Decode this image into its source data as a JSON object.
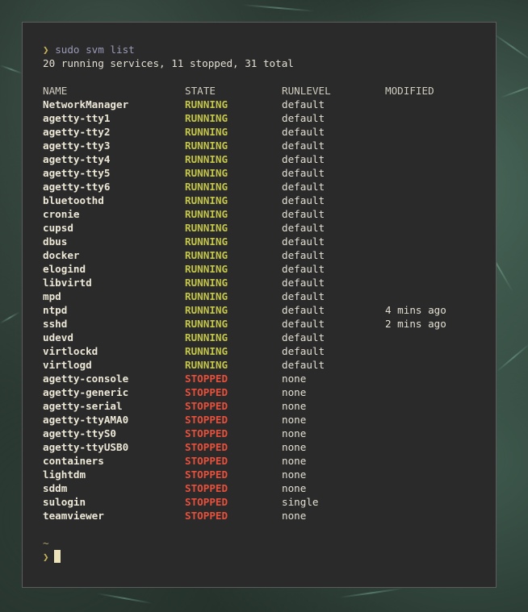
{
  "terminal": {
    "prompt_symbol": "❯",
    "command": "sudo svm list",
    "summary": "20 running services, 11 stopped, 31 total",
    "headers": {
      "name": "NAME",
      "state": "STATE",
      "runlevel": "RUNLEVEL",
      "modified": "MODIFIED"
    },
    "services": [
      {
        "name": "NetworkManager",
        "state": "RUNNING",
        "runlevel": "default",
        "modified": ""
      },
      {
        "name": "agetty-tty1",
        "state": "RUNNING",
        "runlevel": "default",
        "modified": ""
      },
      {
        "name": "agetty-tty2",
        "state": "RUNNING",
        "runlevel": "default",
        "modified": ""
      },
      {
        "name": "agetty-tty3",
        "state": "RUNNING",
        "runlevel": "default",
        "modified": ""
      },
      {
        "name": "agetty-tty4",
        "state": "RUNNING",
        "runlevel": "default",
        "modified": ""
      },
      {
        "name": "agetty-tty5",
        "state": "RUNNING",
        "runlevel": "default",
        "modified": ""
      },
      {
        "name": "agetty-tty6",
        "state": "RUNNING",
        "runlevel": "default",
        "modified": ""
      },
      {
        "name": "bluetoothd",
        "state": "RUNNING",
        "runlevel": "default",
        "modified": ""
      },
      {
        "name": "cronie",
        "state": "RUNNING",
        "runlevel": "default",
        "modified": ""
      },
      {
        "name": "cupsd",
        "state": "RUNNING",
        "runlevel": "default",
        "modified": ""
      },
      {
        "name": "dbus",
        "state": "RUNNING",
        "runlevel": "default",
        "modified": ""
      },
      {
        "name": "docker",
        "state": "RUNNING",
        "runlevel": "default",
        "modified": ""
      },
      {
        "name": "elogind",
        "state": "RUNNING",
        "runlevel": "default",
        "modified": ""
      },
      {
        "name": "libvirtd",
        "state": "RUNNING",
        "runlevel": "default",
        "modified": ""
      },
      {
        "name": "mpd",
        "state": "RUNNING",
        "runlevel": "default",
        "modified": ""
      },
      {
        "name": "ntpd",
        "state": "RUNNING",
        "runlevel": "default",
        "modified": "4 mins ago"
      },
      {
        "name": "sshd",
        "state": "RUNNING",
        "runlevel": "default",
        "modified": "2 mins ago"
      },
      {
        "name": "udevd",
        "state": "RUNNING",
        "runlevel": "default",
        "modified": ""
      },
      {
        "name": "virtlockd",
        "state": "RUNNING",
        "runlevel": "default",
        "modified": ""
      },
      {
        "name": "virtlogd",
        "state": "RUNNING",
        "runlevel": "default",
        "modified": ""
      },
      {
        "name": "agetty-console",
        "state": "STOPPED",
        "runlevel": "none",
        "modified": ""
      },
      {
        "name": "agetty-generic",
        "state": "STOPPED",
        "runlevel": "none",
        "modified": ""
      },
      {
        "name": "agetty-serial",
        "state": "STOPPED",
        "runlevel": "none",
        "modified": ""
      },
      {
        "name": "agetty-ttyAMA0",
        "state": "STOPPED",
        "runlevel": "none",
        "modified": ""
      },
      {
        "name": "agetty-ttyS0",
        "state": "STOPPED",
        "runlevel": "none",
        "modified": ""
      },
      {
        "name": "agetty-ttyUSB0",
        "state": "STOPPED",
        "runlevel": "none",
        "modified": ""
      },
      {
        "name": "containers",
        "state": "STOPPED",
        "runlevel": "none",
        "modified": ""
      },
      {
        "name": "lightdm",
        "state": "STOPPED",
        "runlevel": "none",
        "modified": ""
      },
      {
        "name": "sddm",
        "state": "STOPPED",
        "runlevel": "none",
        "modified": ""
      },
      {
        "name": "sulogin",
        "state": "STOPPED",
        "runlevel": "single",
        "modified": ""
      },
      {
        "name": "teamviewer",
        "state": "STOPPED",
        "runlevel": "none",
        "modified": ""
      }
    ],
    "cwd": "~",
    "colors": {
      "running": "#c4c64a",
      "stopped": "#e8503c",
      "prompt": "#c8b45a",
      "command": "#9a9ab8",
      "background": "#2a2a2a"
    }
  }
}
